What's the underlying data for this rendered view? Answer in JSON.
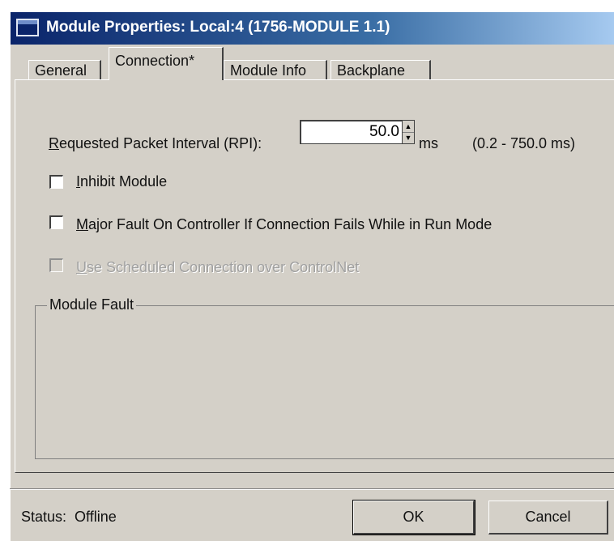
{
  "window": {
    "title": "Module Properties: Local:4 (1756-MODULE 1.1)"
  },
  "tabs": [
    {
      "label": "General"
    },
    {
      "label": "Connection*"
    },
    {
      "label": "Module Info"
    },
    {
      "label": "Backplane"
    }
  ],
  "connection": {
    "rpi_label_first": "R",
    "rpi_label_rest": "equested Packet Interval (RPI):",
    "rpi_value": "50.0",
    "rpi_unit": "ms",
    "rpi_range": "(0.2 - 750.0 ms)",
    "inhibit_first": "I",
    "inhibit_rest": "nhibit Module",
    "major_fault_first": "M",
    "major_fault_rest": "ajor Fault On Controller If Connection Fails While in Run Mode",
    "scheduled_first": "U",
    "scheduled_rest": "se Scheduled Connection over ControlNet",
    "module_fault_legend": "Module Fault"
  },
  "footer": {
    "status_label": "Status:",
    "status_value": "Offline",
    "ok_label": "OK",
    "cancel_label": "Cancel"
  }
}
